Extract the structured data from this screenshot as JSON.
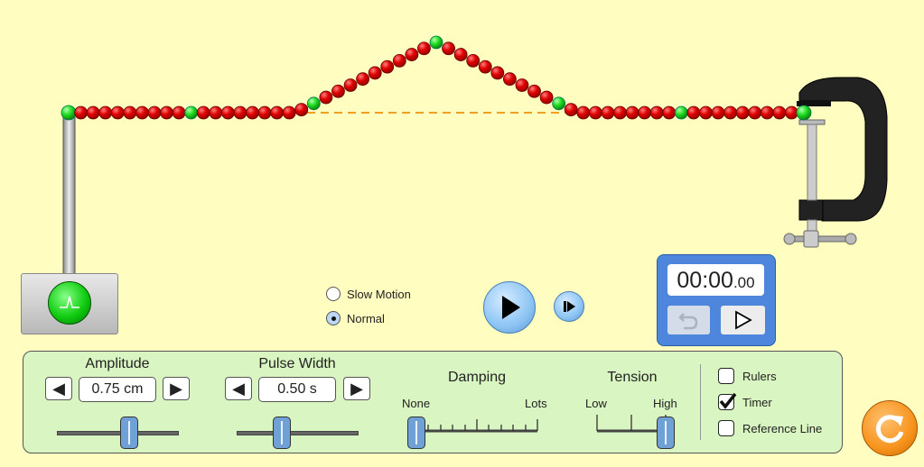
{
  "simulation": {
    "bead_count": 61,
    "highlight_every": 10,
    "colors": {
      "background": "#fffdbf",
      "bead": "#e00000",
      "bead_highlight": "#22dd22",
      "reference_line": "#f0a020",
      "panel": "#d9f5c1",
      "slider_thumb": "#6fa0d6",
      "timer_body": "#4d86dc",
      "reset_button": "#f7941d"
    }
  },
  "pulse_generator": {
    "icon": "pulse-icon"
  },
  "speed": {
    "options": [
      {
        "label": "Slow Motion",
        "selected": false
      },
      {
        "label": "Normal",
        "selected": true
      }
    ]
  },
  "playback": {
    "play_icon": "play-icon",
    "step_icon": "step-forward-icon"
  },
  "timer": {
    "time_main": "00:00",
    "time_fraction": ".00",
    "reset_icon": "undo-icon",
    "start_icon": "play-outline-icon"
  },
  "controls": {
    "amplitude": {
      "label": "Amplitude",
      "value": "0.75 cm",
      "fraction": 0.55
    },
    "pulse_width": {
      "label": "Pulse Width",
      "value": "0.50 s",
      "fraction": 0.38
    },
    "damping": {
      "label": "Damping",
      "min_label": "None",
      "max_label": "Lots",
      "fraction": 0.0
    },
    "tension": {
      "label": "Tension",
      "min_label": "Low",
      "max_label": "High",
      "fraction": 1.0
    }
  },
  "checkboxes": [
    {
      "label": "Rulers",
      "checked": false
    },
    {
      "label": "Timer",
      "checked": true
    },
    {
      "label": "Reference Line",
      "checked": false
    }
  ],
  "reset_all": {
    "icon": "reset-icon"
  }
}
